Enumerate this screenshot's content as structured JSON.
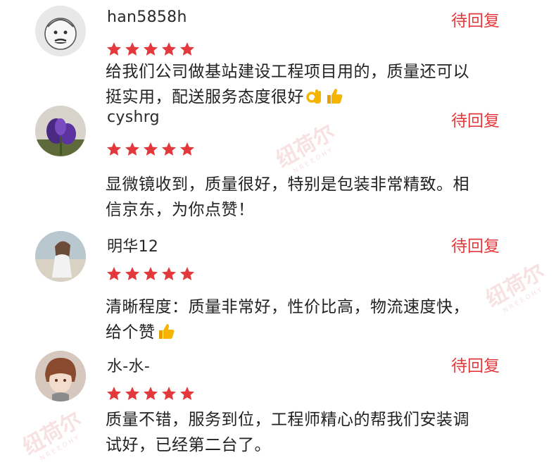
{
  "reviews": [
    {
      "username": "han5858h",
      "reply_status": "待回复",
      "rating": 5,
      "avatar_icon": "cartoon-face-avatar",
      "content_lines": [
        "给我们公司做基站建设工程项目用的，质量还可以",
        "挺实用，配送服务态度很好"
      ],
      "emojis": [
        "ok-hand-emoji",
        "thumbs-up-emoji"
      ]
    },
    {
      "username": "cyshrg",
      "reply_status": "待回复",
      "rating": 5,
      "avatar_icon": "purple-flower-avatar",
      "content_lines": [
        "显微镜收到，质量很好，特别是包装非常精致。相",
        "信京东，为你点赞！"
      ],
      "emojis": []
    },
    {
      "username": "明华12",
      "reply_status": "待回复",
      "rating": 5,
      "avatar_icon": "girl-photo-avatar",
      "content_lines": [
        "清晰程度：质量非常好，性价比高，物流速度快，",
        "给个赞"
      ],
      "emojis": [
        "thumbs-up-emoji"
      ]
    },
    {
      "username": "水-水-",
      "reply_status": "待回复",
      "rating": 5,
      "avatar_icon": "anime-boy-avatar",
      "content_lines": [
        "质量不错，服务到位，工程师精心的帮我们安装调",
        "试好，已经第二台了。"
      ],
      "emojis": []
    }
  ],
  "watermark": {
    "brand": "纽荷尔",
    "brand_en": "NREEOHY"
  },
  "colors": {
    "accent": "#e4393c",
    "star": "#e4393c",
    "text": "#222222"
  }
}
